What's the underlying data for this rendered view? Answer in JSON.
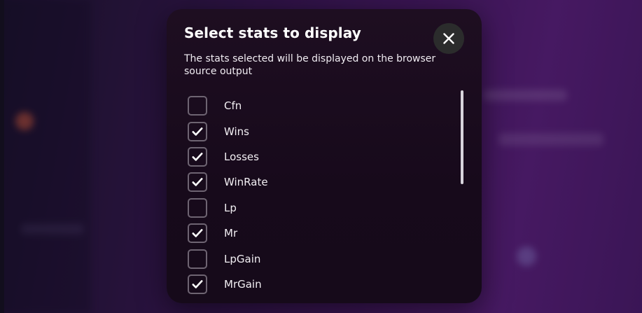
{
  "dialog": {
    "title": "Select stats to display",
    "description": "The stats selected will be displayed on the browser source output",
    "close_icon": "close-icon"
  },
  "stats": [
    {
      "label": "Cfn",
      "checked": false
    },
    {
      "label": "Wins",
      "checked": true
    },
    {
      "label": "Losses",
      "checked": true
    },
    {
      "label": "WinRate",
      "checked": true
    },
    {
      "label": "Lp",
      "checked": false
    },
    {
      "label": "Mr",
      "checked": true
    },
    {
      "label": "LpGain",
      "checked": false
    },
    {
      "label": "MrGain",
      "checked": true
    }
  ],
  "colors": {
    "accent_purple": "#5a1f7c",
    "modal_bg": "#170a1b",
    "close_button_bg": "#2b2c2c",
    "checkbox_border": "#6e6472"
  }
}
